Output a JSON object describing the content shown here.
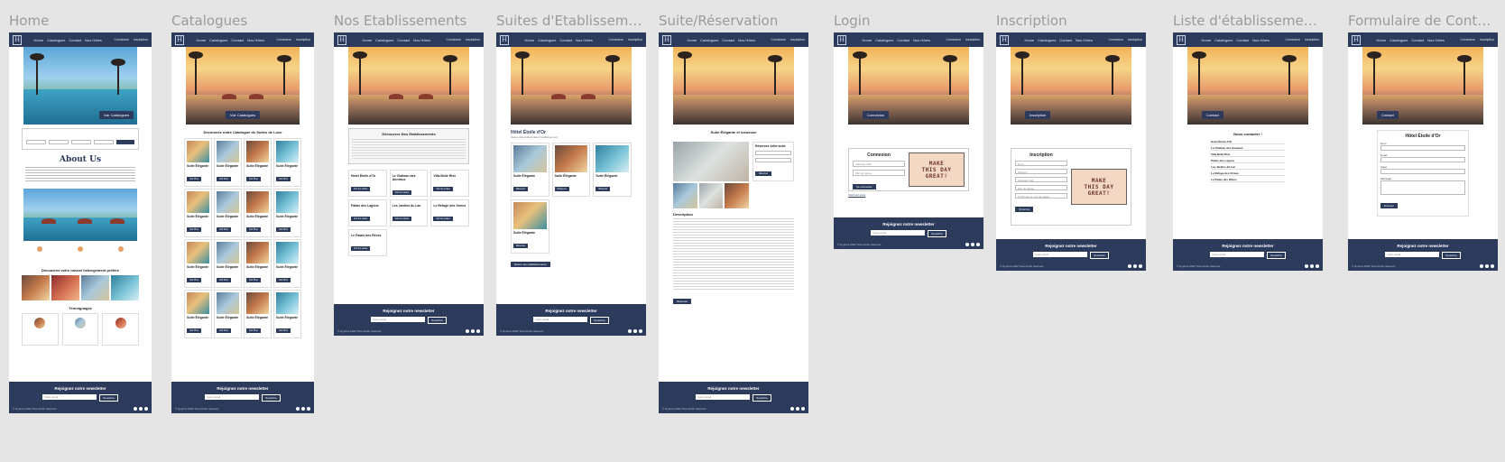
{
  "frames": [
    {
      "title": "Home"
    },
    {
      "title": "Catalogues"
    },
    {
      "title": "Nos Etablissements"
    },
    {
      "title": "Suites d'Etablissement..."
    },
    {
      "title": "Suite/Réservation"
    },
    {
      "title": "Login"
    },
    {
      "title": "Inscription"
    },
    {
      "title": "Liste d'établissement ..."
    },
    {
      "title": "Formulaire de Contact"
    }
  ],
  "nav": {
    "links": [
      "Home",
      "Catalogues",
      "Contact",
      "Nos Hôtes"
    ],
    "actions": [
      "Connexion",
      "Inscription"
    ],
    "logo": "H"
  },
  "footer": {
    "title": "Rejoignez notre newsletter",
    "subtitle": "Inscrivez-vous à notre newsletter pour découvrir nos offres",
    "placeholder": "Votre email",
    "button": "Souscrire",
    "copyright": "© Hypnos 2022 Tous droits réservés"
  },
  "home": {
    "hero_btn": "Voir Catalogues",
    "about_title": "About Us",
    "hotels_title": "Découvrez votre nouvel hébergement préféré",
    "testimonials_title": "Témoignages"
  },
  "catalogue": {
    "heading": "Découvrez notre Catalogue de Suites de Luxe",
    "card_title": "Suite Élégante",
    "card_btn": "Voir Plus"
  },
  "etabs": {
    "heading": "Découvrez Nos Etablissements",
    "items": [
      "Hotel Étoile d'Or",
      "Le Château des Anneaux",
      "Villa Belle Rive",
      "Palais des Lagons",
      "Les Jardins du Lac",
      "Le Refuge des Ormes",
      "Le Palais des Rêves"
    ],
    "btn": "Voir les suites"
  },
  "suites": {
    "heading": "Hôtel Étoile d'Or",
    "sub": "Suites disponibles dans l'établissement",
    "btn": "Réserver",
    "back": "Retour aux établissements"
  },
  "reservation": {
    "heading": "Suite Élégante et luxueuse",
    "form_title": "Réservez cette suite",
    "desc_title": "Description",
    "book_btn": "Réserver"
  },
  "login": {
    "hero_btn": "Connexion",
    "title": "Connexion",
    "email": "Adresse mail",
    "password": "Mot de passe",
    "btn": "Se connecter",
    "signup": "Inscrivez-vous"
  },
  "signup": {
    "title": "Inscription",
    "fields": [
      "Nom",
      "Prénom",
      "Adresse mail",
      "Mot de passe",
      "Confirmer le mot de passe"
    ],
    "btn": "S'inscrire"
  },
  "list": {
    "title": "Nous contacter !",
    "hotels": [
      "Hotel Étoile d'Or",
      "Le Château des Anneaux",
      "Villa Belle Rive",
      "Palais des Lagons",
      "Les Jardins du Lac",
      "Le Refuge des Ormes",
      "Le Palais des Rêves"
    ]
  },
  "contact": {
    "title": "Hôtel Étoile d'Or",
    "fields": [
      "Nom",
      "Email",
      "Sujet",
      "Message"
    ],
    "btn": "Envoyer"
  },
  "make_day": [
    "MAKE",
    "THIS DAY",
    "GREAT!"
  ],
  "colors": {
    "navy": "#2c3a5c",
    "canvas": "#e5e5e5"
  }
}
